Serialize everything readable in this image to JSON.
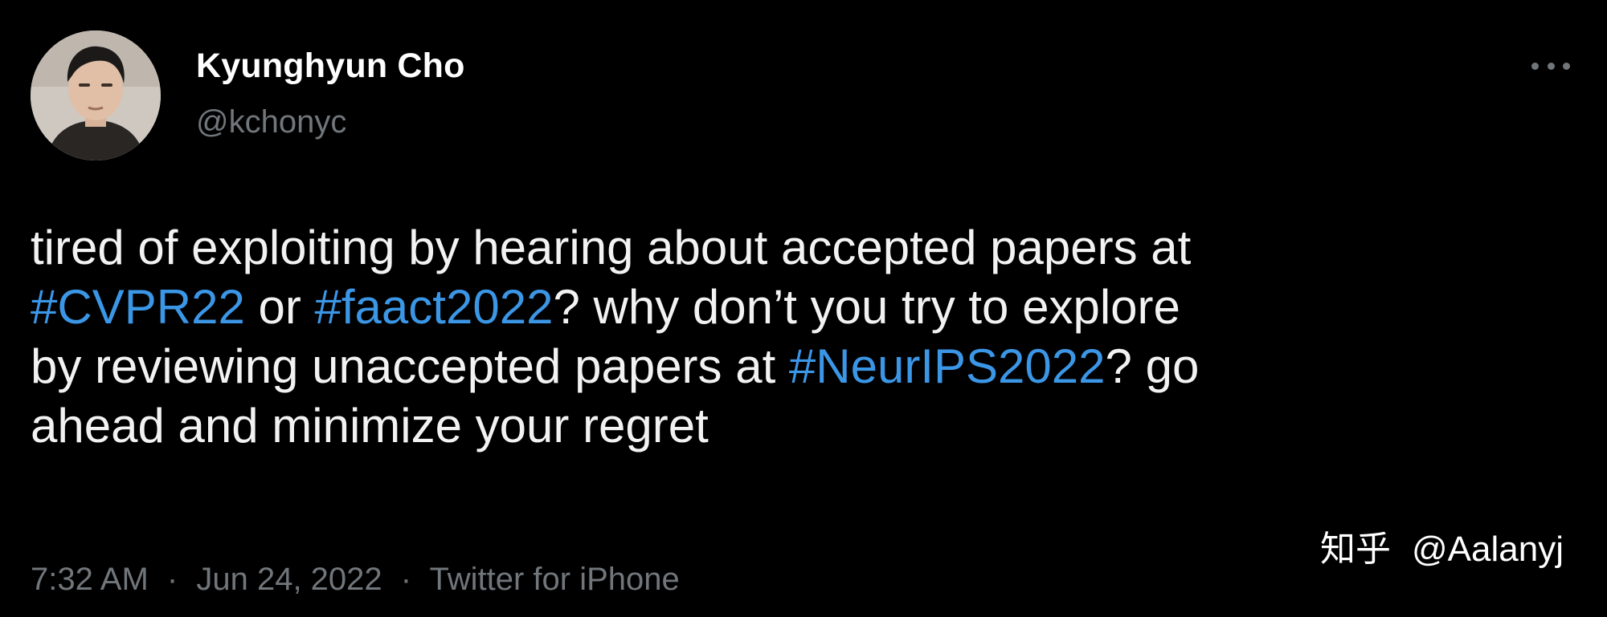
{
  "author": {
    "display_name": "Kyunghyun Cho",
    "handle": "@kchonyc"
  },
  "more_icon": "more-horizontal-icon",
  "tweet": {
    "lines": [
      [
        {
          "text": "tired of exploiting by hearing about accepted papers at",
          "hashtag": false
        }
      ],
      [
        {
          "text": "#CVPR22",
          "hashtag": true
        },
        {
          "text": " or ",
          "hashtag": false
        },
        {
          "text": "#faact2022",
          "hashtag": true
        },
        {
          "text": "? why don’t you try to explore",
          "hashtag": false
        }
      ],
      [
        {
          "text": "by reviewing unaccepted papers at ",
          "hashtag": false
        },
        {
          "text": "#NeurIPS2022",
          "hashtag": true
        },
        {
          "text": "? go",
          "hashtag": false
        }
      ],
      [
        {
          "text": "ahead and minimize your regret",
          "hashtag": false
        }
      ]
    ]
  },
  "meta": {
    "time": "7:32 AM",
    "separator": "·",
    "date": "Jun 24, 2022",
    "source": "Twitter for iPhone"
  },
  "watermark": {
    "site": "知乎",
    "user": "@Aalanyj"
  },
  "colors": {
    "background": "#000000",
    "hashtag": "#3b96e6",
    "secondary_text": "#71767b",
    "primary_text": "#f2f2f2"
  }
}
